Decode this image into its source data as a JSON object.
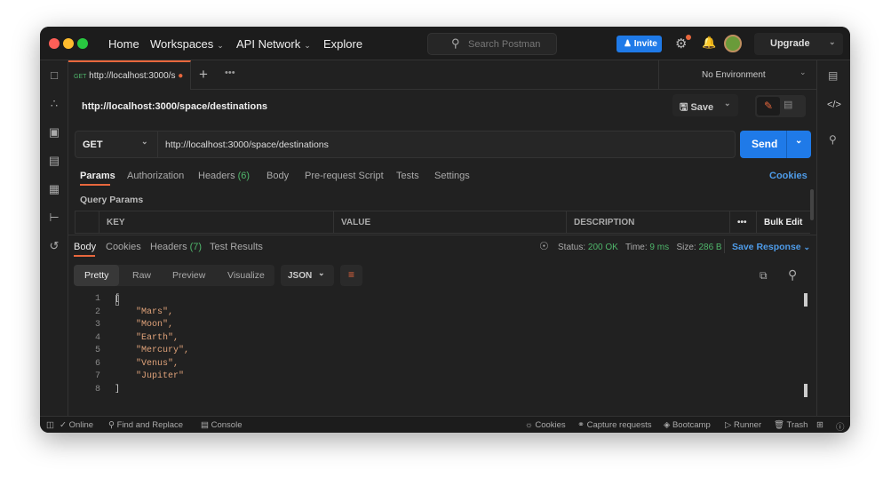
{
  "titlebar": {
    "nav": [
      "Home",
      "Workspaces",
      "API Network",
      "Explore"
    ],
    "search_placeholder": "Search Postman",
    "invite": "Invite",
    "upgrade": "Upgrade"
  },
  "tabs": {
    "request_tab": {
      "method": "GET",
      "title": "http://localhost:3000/s"
    },
    "environment": "No Environment"
  },
  "request": {
    "name": "http://localhost:3000/space/destinations",
    "save": "Save",
    "method": "GET",
    "url": "http://localhost:3000/space/destinations",
    "send": "Send",
    "tabs": [
      {
        "label": "Params"
      },
      {
        "label": "Authorization"
      },
      {
        "label": "Headers",
        "count": "(6)"
      },
      {
        "label": "Body"
      },
      {
        "label": "Pre-request Script"
      },
      {
        "label": "Tests"
      },
      {
        "label": "Settings"
      }
    ],
    "cookies": "Cookies",
    "query_params": "Query Params",
    "columns": [
      "KEY",
      "VALUE",
      "DESCRIPTION"
    ],
    "bulk_edit": "Bulk Edit"
  },
  "response": {
    "tabs": [
      {
        "label": "Body"
      },
      {
        "label": "Cookies"
      },
      {
        "label": "Headers",
        "count": "(7)"
      },
      {
        "label": "Test Results"
      }
    ],
    "status_label": "Status:",
    "status": "200 OK",
    "time_label": "Time:",
    "time": "9 ms",
    "size_label": "Size:",
    "size": "286 B",
    "save_response": "Save Response",
    "views": [
      "Pretty",
      "Raw",
      "Preview",
      "Visualize"
    ],
    "format": "JSON",
    "lines": [
      {
        "n": "1",
        "t": "["
      },
      {
        "n": "2",
        "t": "    \"Mars\","
      },
      {
        "n": "3",
        "t": "    \"Moon\","
      },
      {
        "n": "4",
        "t": "    \"Earth\","
      },
      {
        "n": "5",
        "t": "    \"Mercury\","
      },
      {
        "n": "6",
        "t": "    \"Venus\","
      },
      {
        "n": "7",
        "t": "    \"Jupiter\""
      },
      {
        "n": "8",
        "t": "]"
      }
    ]
  },
  "statusbar": {
    "online": "Online",
    "find": "Find and Replace",
    "console": "Console",
    "cookies": "Cookies",
    "capture": "Capture requests",
    "bootcamp": "Bootcamp",
    "runner": "Runner",
    "trash": "Trash"
  }
}
